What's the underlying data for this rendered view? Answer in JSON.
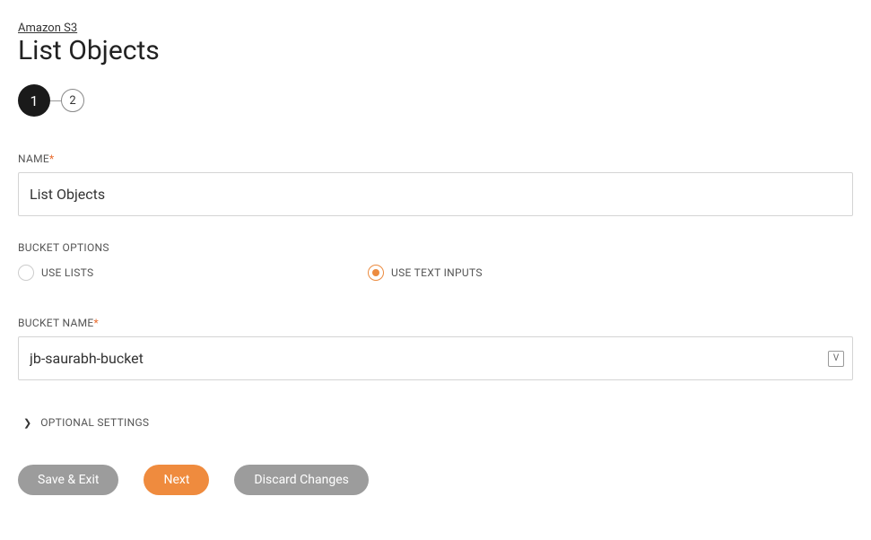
{
  "breadcrumb": {
    "label": "Amazon S3"
  },
  "page": {
    "title": "List Objects"
  },
  "stepper": {
    "step1": "1",
    "step2": "2"
  },
  "fields": {
    "name": {
      "label": "NAME",
      "value": "List Objects"
    },
    "bucketOptions": {
      "label": "BUCKET OPTIONS",
      "option1": "USE LISTS",
      "option2": "USE TEXT INPUTS"
    },
    "bucketName": {
      "label": "BUCKET NAME",
      "value": "jb-saurabh-bucket",
      "iconLabel": "V"
    }
  },
  "expand": {
    "optionalSettings": "OPTIONAL SETTINGS"
  },
  "buttons": {
    "saveExit": "Save & Exit",
    "next": "Next",
    "discard": "Discard Changes"
  },
  "required": "*"
}
